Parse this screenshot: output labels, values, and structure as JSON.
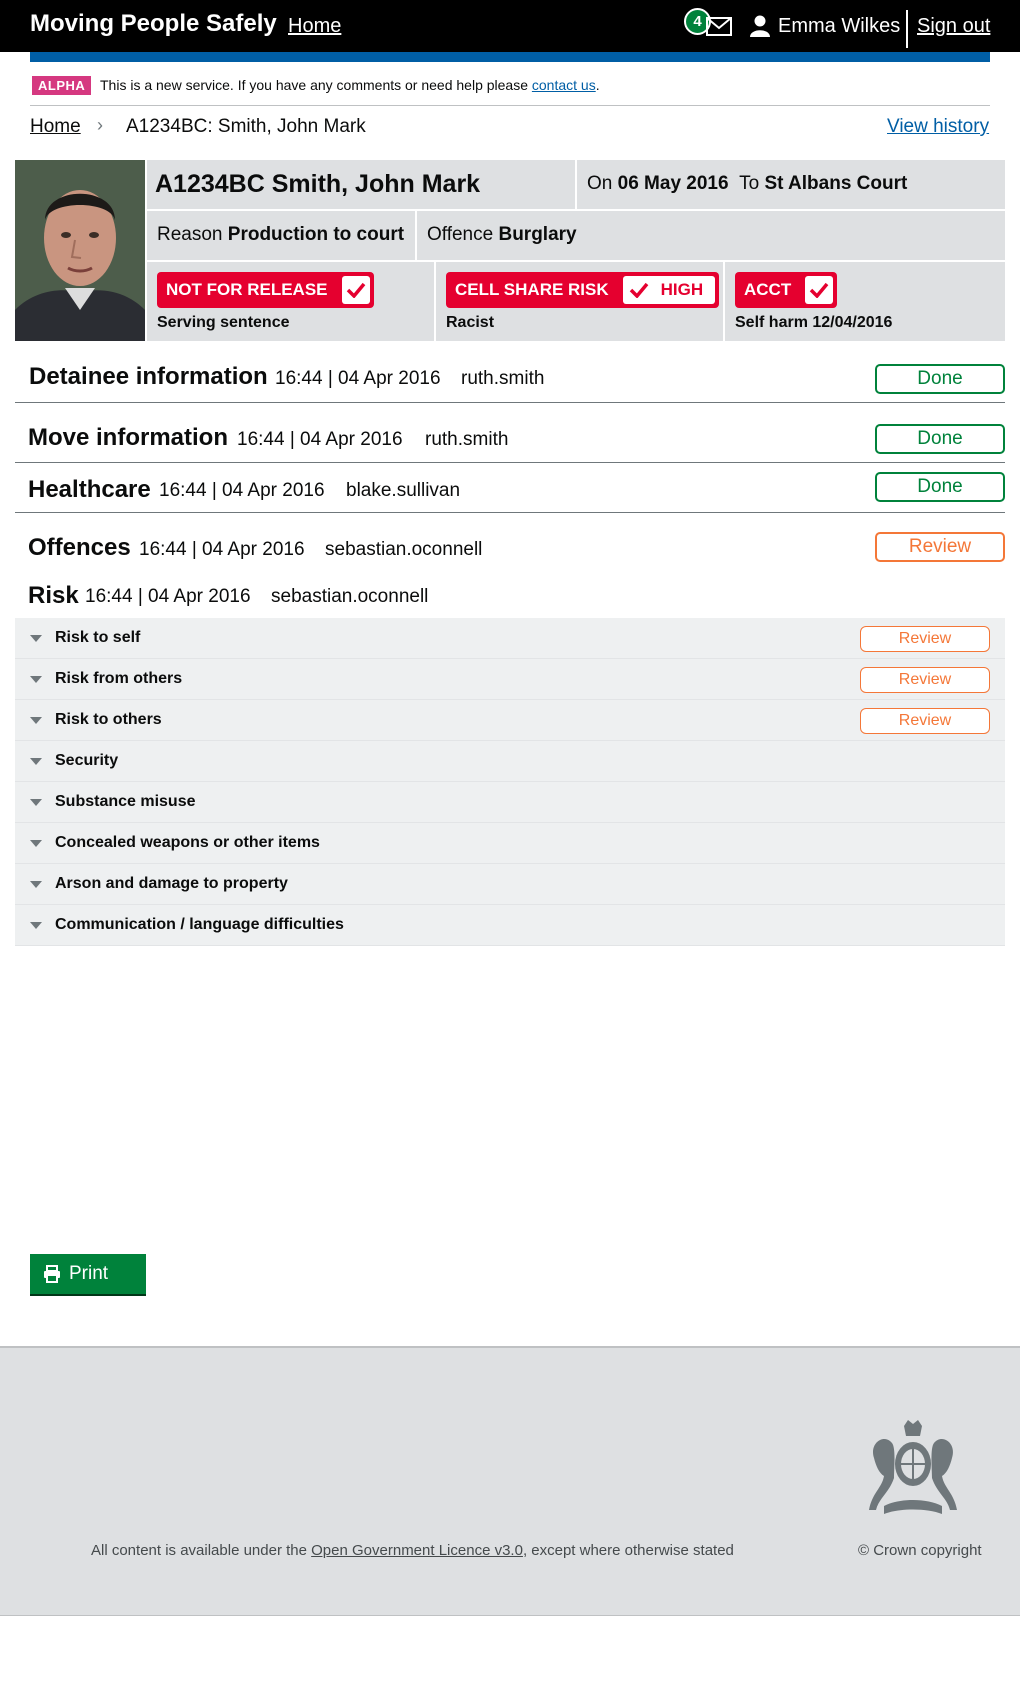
{
  "header": {
    "service_name": "Moving People Safely",
    "home_link": "Home",
    "notification_count": "4",
    "user_name": "Emma Wilkes",
    "sign_out": "Sign out"
  },
  "phase_banner": {
    "tag": "ALPHA",
    "text": "This is a new service. If you have any comments or need help please ",
    "link": "contact us",
    "suffix": "."
  },
  "breadcrumb": {
    "home": "Home",
    "current": "A1234BC: Smith, John Mark",
    "view_history": "View history"
  },
  "detainee": {
    "name": "A1234BC Smith, John Mark",
    "date_label": "On",
    "date": "06 May 2016",
    "to_label": "To",
    "destination": "St Albans Court",
    "reason_label": "Reason",
    "reason": "Production to court",
    "offence_label": "Offence",
    "offence": "Burglary"
  },
  "alerts": [
    {
      "label": "NOT FOR RELEASE",
      "sub": "Serving sentence"
    },
    {
      "label": "CELL SHARE RISK",
      "level": "HIGH",
      "sub": "Racist"
    },
    {
      "label": "ACCT",
      "sub": "Self harm 12/04/2016"
    }
  ],
  "sections": [
    {
      "title": "Detainee information",
      "timestamp": "16:44 | 04 Apr 2016",
      "user": "ruth.smith",
      "status": "Done"
    },
    {
      "title": "Move information",
      "timestamp": "16:44 | 04 Apr 2016",
      "user": "ruth.smith",
      "status": "Done"
    },
    {
      "title": "Healthcare",
      "timestamp": "16:44 | 04 Apr 2016",
      "user": "blake.sullivan",
      "status": "Done"
    },
    {
      "title": "Offences",
      "timestamp": "16:44 | 04 Apr 2016",
      "user": "sebastian.oconnell",
      "status": "Review"
    },
    {
      "title": "Risk",
      "timestamp": "16:44 | 04 Apr 2016",
      "user": "sebastian.oconnell"
    }
  ],
  "risk_items": [
    {
      "label": "Risk to self",
      "status": "Review"
    },
    {
      "label": "Risk from others",
      "status": "Review"
    },
    {
      "label": "Risk to others",
      "status": "Review"
    },
    {
      "label": "Security"
    },
    {
      "label": "Substance misuse"
    },
    {
      "label": "Concealed weapons or other items"
    },
    {
      "label": "Arson and damage to property"
    },
    {
      "label": "Communication / language difficulties"
    }
  ],
  "print_label": "Print",
  "footer": {
    "licence_prefix": "All content is available under the ",
    "licence_link": "Open Government Licence v3.0",
    "licence_suffix": ", except where otherwise stated",
    "copyright": "© Crown copyright"
  },
  "colors": {
    "header_bg": "#000000",
    "brand_blue": "#005ea5",
    "alpha_pink": "#d53880",
    "alert_red": "#e5002f",
    "done_green": "#00823b",
    "review_orange": "#f47738",
    "panel_grey": "#dee0e2"
  }
}
